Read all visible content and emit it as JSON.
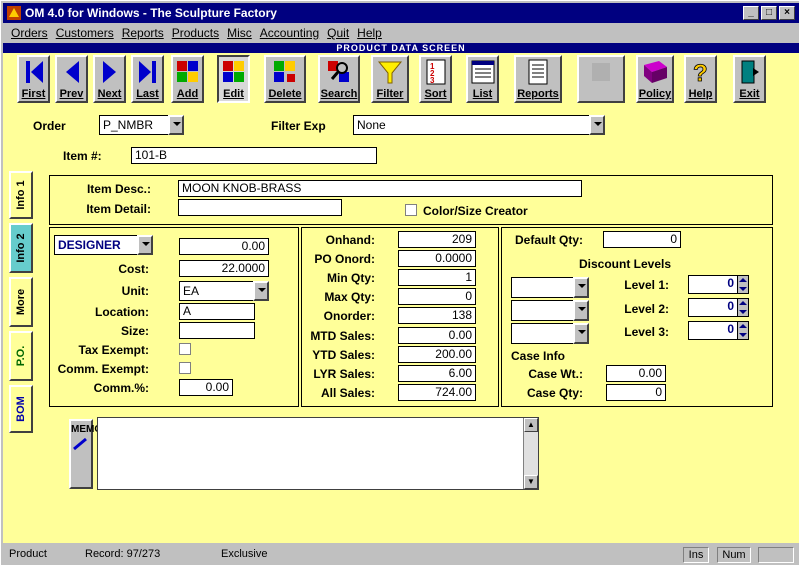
{
  "window": {
    "title": "OM 4.0 for Windows - The Sculpture Factory"
  },
  "menu": [
    "Orders",
    "Customers",
    "Reports",
    "Products",
    "Misc",
    "Accounting",
    "Quit",
    "Help"
  ],
  "screen_title": "PRODUCT DATA SCREEN",
  "toolbar": {
    "first": "First",
    "prev": "Prev",
    "next": "Next",
    "last": "Last",
    "add": "Add",
    "edit": "Edit",
    "delete": "Delete",
    "search": "Search",
    "filter": "Filter",
    "sort": "Sort",
    "list": "List",
    "reports": "Reports",
    "policy": "Policy",
    "help": "Help",
    "exit": "Exit"
  },
  "order": {
    "label": "Order",
    "value": "P_NMBR"
  },
  "filter": {
    "label": "Filter Exp",
    "value": "None"
  },
  "item": {
    "label": "Item #:",
    "value": "101-B"
  },
  "desc": {
    "label": "Item Desc.:",
    "value": "MOON KNOB-BRASS",
    "detail_label": "Item Detail:",
    "detail_value": "",
    "color_size": "Color/Size Creator"
  },
  "tabs": [
    "Info 1",
    "Info 2",
    "More",
    "P.O.",
    "BOM"
  ],
  "left": {
    "designer": "DESIGNER",
    "designer_value": "0.00",
    "cost_label": "Cost:",
    "cost": "22.0000",
    "unit_label": "Unit:",
    "unit": "EA",
    "location_label": "Location:",
    "location": "A",
    "size_label": "Size:",
    "size": "",
    "tax_label": "Tax Exempt:",
    "comm_exempt_label": "Comm. Exempt:",
    "comm_pct_label": "Comm.%:",
    "comm_pct": "0.00"
  },
  "middle": {
    "onhand_label": "Onhand:",
    "onhand": "209",
    "po_label": "PO Onord:",
    "po": "0.0000",
    "min_label": "Min Qty:",
    "min": "1",
    "max_label": "Max Qty:",
    "max": "0",
    "onorder_label": "Onorder:",
    "onorder": "138",
    "mtd_label": "MTD Sales:",
    "mtd": "0.00",
    "ytd_label": "YTD Sales:",
    "ytd": "200.00",
    "lyr_label": "LYR Sales:",
    "lyr": "6.00",
    "all_label": "All Sales:",
    "all": "724.00"
  },
  "right": {
    "default_label": "Default Qty:",
    "default": "0",
    "discount_title": "Discount Levels",
    "level1_label": "Level 1:",
    "level1": "0",
    "level2_label": "Level 2:",
    "level2": "0",
    "level3_label": "Level 3:",
    "level3": "0",
    "case_title": "Case Info",
    "case_wt_label": "Case Wt.:",
    "case_wt": "0.00",
    "case_qty_label": "Case Qty:",
    "case_qty": "0"
  },
  "memo": {
    "label": "MEMO",
    "value": ""
  },
  "status": {
    "mode": "Product",
    "record": "Record: 97/273",
    "lock": "Exclusive",
    "ins": "Ins",
    "num": "Num"
  }
}
